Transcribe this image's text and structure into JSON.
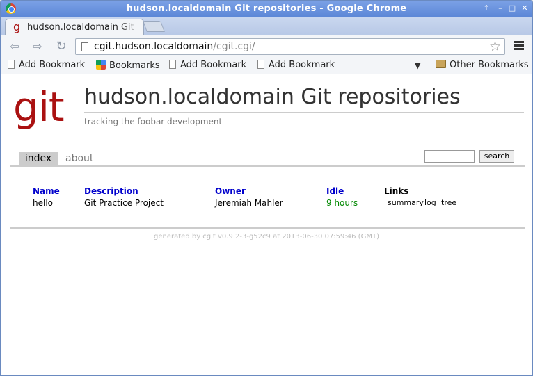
{
  "window": {
    "title": "hudson.localdomain Git repositories - Google Chrome",
    "controls": [
      "↑",
      "–",
      "□",
      "✕"
    ]
  },
  "browser": {
    "tab_title": "hudson.localdomain Git repositories",
    "tab_favicon": "g",
    "url_host": "cgit.hudson.localdomain",
    "url_path": "/cgit.cgi/",
    "icons": {
      "back": "back-arrow-icon",
      "forward": "forward-arrow-icon",
      "reload": "reload-icon",
      "star": "bookmark-star-icon",
      "menu": "hamburger-menu-icon"
    },
    "bookmarks": [
      {
        "label": "Add Bookmark",
        "icon": "page-icon"
      },
      {
        "label": "Bookmarks",
        "icon": "google-icon"
      },
      {
        "label": "Add Bookmark",
        "icon": "page-icon"
      },
      {
        "label": "Add Bookmark",
        "icon": "page-icon"
      }
    ],
    "other_bookmarks": "Other Bookmarks"
  },
  "page": {
    "logo": "git",
    "title": "hudson.localdomain Git repositories",
    "subtitle": "tracking the foobar development",
    "tabs": {
      "index": "index",
      "about": "about"
    },
    "search_button": "search",
    "search_value": "",
    "table": {
      "headers": {
        "name": "Name",
        "description": "Description",
        "owner": "Owner",
        "idle": "Idle",
        "links": "Links"
      },
      "rows": [
        {
          "name": "hello",
          "description": "Git Practice Project",
          "owner": "Jeremiah Mahler",
          "idle": "9 hours",
          "links": [
            "summary",
            "log",
            "tree"
          ]
        }
      ]
    },
    "footer": "generated by cgit v0.9.2-3-g52c9 at 2013-06-30 07:59:46 (GMT)"
  },
  "colors": {
    "logo_red": "#aa1111",
    "header_blue": "#0000cc",
    "idle_green": "#008800",
    "rule_gray": "#cccccc"
  }
}
